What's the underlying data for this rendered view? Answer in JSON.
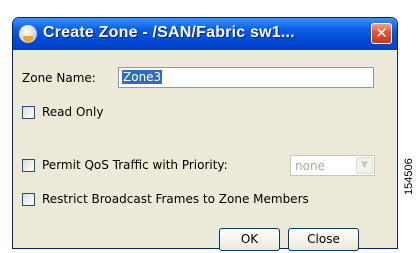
{
  "window": {
    "title": "Create Zone - /SAN/Fabric sw1...",
    "close_glyph": "✕"
  },
  "form": {
    "zone_name_label": "Zone Name:",
    "zone_name_value": "Zone3",
    "read_only_label": "Read Only",
    "permit_qos_label": "Permit QoS Traffic with Priority:",
    "priority_value": "none",
    "restrict_broadcast_label": "Restrict Broadcast Frames to Zone Members"
  },
  "buttons": {
    "ok": "OK",
    "close": "Close"
  },
  "figure_code": "154506",
  "colors": {
    "titlebar": "#0048d6",
    "close_button": "#e0542e",
    "dialog_bg": "#ece9d8",
    "selection": "#316ac5"
  },
  "icons": {
    "app": "app-globe-icon",
    "close": "close-icon",
    "dropdown": "chevron-down-icon"
  }
}
